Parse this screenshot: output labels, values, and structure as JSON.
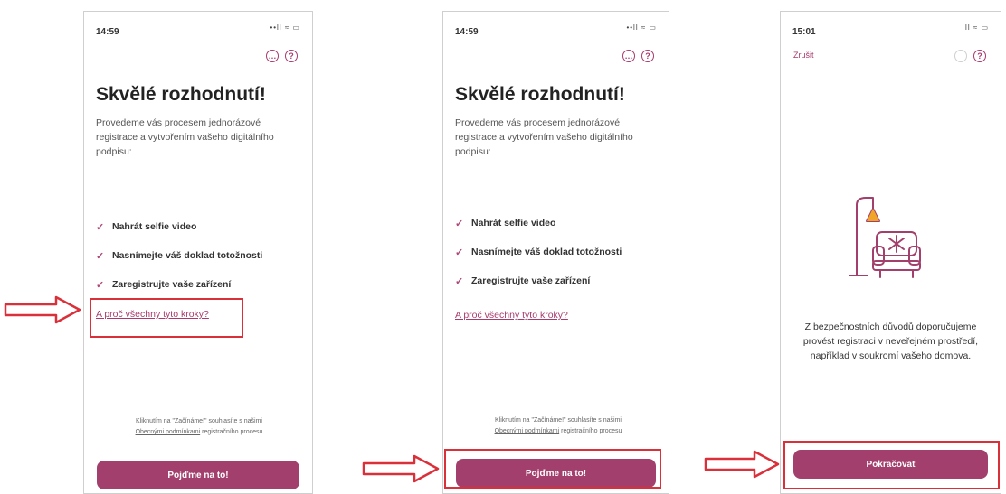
{
  "screen1": {
    "time": "14:59",
    "status_icons": "••ll ≈ ▭",
    "title": "Skvělé rozhodnutí!",
    "intro": "Provedeme vás procesem jednorázové registrace a vytvořením vašeho digitálního podpisu:",
    "steps": [
      "Nahrát selfie video",
      "Nasnímejte váš doklad totožnosti",
      "Zaregistrujte vaše zařízení"
    ],
    "link": "A proč všechny tyto kroky?",
    "consent_line1": "Kliknutím na \"Začínáme!\" souhlasíte s našimi",
    "consent_link": "Obecnými podmínkami",
    "consent_line2": "registračního procesu",
    "button": "Pojďme na to!"
  },
  "screen2": {
    "time": "14:59",
    "status_icons": "••ll ≈ ▭",
    "title": "Skvělé rozhodnutí!",
    "intro": "Provedeme vás procesem jednorázové registrace a vytvořením vašeho digitálního podpisu:",
    "steps": [
      "Nahrát selfie video",
      "Nasnímejte váš doklad totožnosti",
      "Zaregistrujte vaše zařízení"
    ],
    "link": "A proč všechny tyto kroky?",
    "consent_line1": "Kliknutím na \"Začínáme!\" souhlasíte s našimi",
    "consent_link": "Obecnými podmínkami",
    "consent_line2": "registračního procesu",
    "button": "Pojďme na to!"
  },
  "screen3": {
    "time": "15:01",
    "status_icons": "ll ≈ ▭",
    "cancel": "Zrušit",
    "message": "Z bezpečnostních důvodů doporučujeme provést registraci v neveřejném prostředí, například v soukromí vašeho domova.",
    "button": "Pokračovat"
  },
  "icons": {
    "chat": "chat-icon",
    "help": "help-icon",
    "check": "check-icon",
    "arrow": "arrow-right-icon",
    "illustration": "armchair-lamp-illustration"
  },
  "colors": {
    "accent": "#a23f6c",
    "highlight": "#d9303a"
  }
}
